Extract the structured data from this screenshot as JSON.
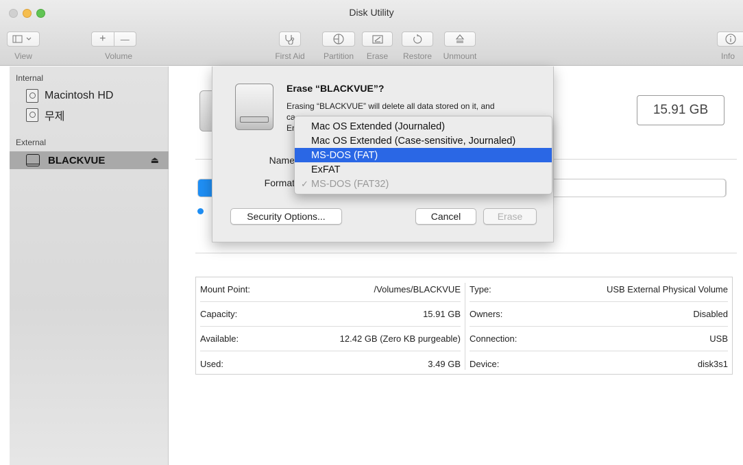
{
  "window": {
    "title": "Disk Utility"
  },
  "toolbar": {
    "view_label": "View",
    "volume_label": "Volume",
    "first_aid_label": "First Aid",
    "partition_label": "Partition",
    "erase_label": "Erase",
    "restore_label": "Restore",
    "unmount_label": "Unmount",
    "info_label": "Info",
    "plus_glyph": "+",
    "minus_glyph": "—"
  },
  "sidebar": {
    "internal_header": "Internal",
    "external_header": "External",
    "internal_items": [
      {
        "label": "Macintosh HD"
      },
      {
        "label": "무제"
      }
    ],
    "external_items": [
      {
        "label": "BLACKVUE",
        "selected": true
      }
    ]
  },
  "main": {
    "capacity": "15.91 GB",
    "usage_fraction": 0.22
  },
  "info": {
    "left": [
      {
        "label": "Mount Point:",
        "value": "/Volumes/BLACKVUE"
      },
      {
        "label": "Capacity:",
        "value": "15.91 GB"
      },
      {
        "label": "Available:",
        "value": "12.42 GB (Zero KB purgeable)"
      },
      {
        "label": "Used:",
        "value": "3.49 GB"
      }
    ],
    "right": [
      {
        "label": "Type:",
        "value": "USB External Physical Volume"
      },
      {
        "label": "Owners:",
        "value": "Disabled"
      },
      {
        "label": "Connection:",
        "value": "USB"
      },
      {
        "label": "Device:",
        "value": "disk3s1"
      }
    ]
  },
  "sheet": {
    "title": "Erase “BLACKVUE”?",
    "line1": "Erasing “BLACKVUE” will delete all data stored on it, and",
    "line2_peek": "ca",
    "line3_peek": "Er",
    "name_label": "Name",
    "format_label": "Format",
    "security_options": "Security Options...",
    "cancel": "Cancel",
    "erase": "Erase"
  },
  "format_menu": {
    "options": [
      {
        "label": "Mac OS Extended (Journaled)"
      },
      {
        "label": "Mac OS Extended (Case-sensitive, Journaled)"
      },
      {
        "label": "MS-DOS (FAT)",
        "highlighted": true
      },
      {
        "label": "ExFAT"
      }
    ],
    "current": {
      "label": "MS-DOS (FAT32)",
      "check": "✓"
    }
  },
  "colors": {
    "accent_blue": "#1f8ff5",
    "menu_highlight": "#2a67e5"
  }
}
